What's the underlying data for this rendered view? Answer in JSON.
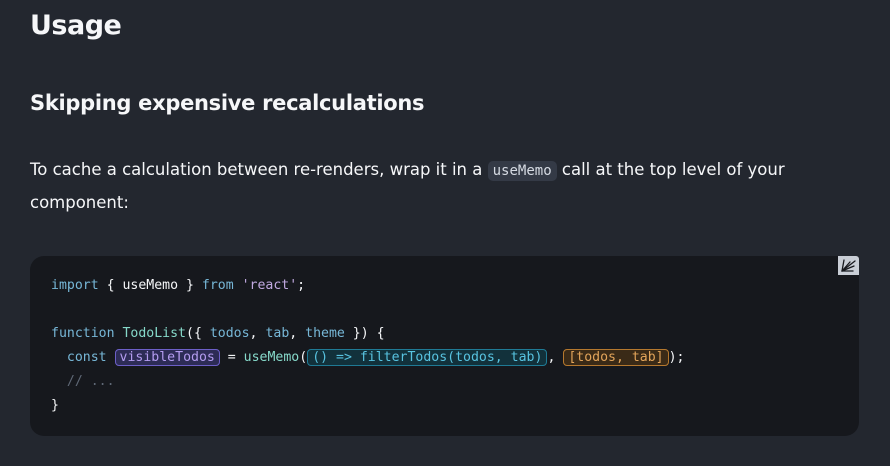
{
  "section": {
    "title": "Usage"
  },
  "subsection": {
    "title": "Skipping expensive recalculations"
  },
  "paragraph": {
    "text_before": "To cache a calculation between re-renders, wrap it in a ",
    "inline_code": "useMemo",
    "text_after": " call at the top level of your component:"
  },
  "code": {
    "copy_icon": "copy-icon",
    "line1": {
      "import_kw": "import",
      "open": " { ",
      "name": "useMemo",
      "close": " } ",
      "from_kw": "from",
      "module": "'react'",
      "end": ";"
    },
    "line3": {
      "function_kw": "function",
      "name": "TodoList",
      "open": "({ ",
      "p1": "todos",
      "c1": ", ",
      "p2": "tab",
      "c2": ", ",
      "p3": "theme",
      "close": " }) {"
    },
    "line4": {
      "indent": "  ",
      "const_kw": "const",
      "var_name": "visibleTodos",
      "assign": " = ",
      "call": "useMemo",
      "open": "(",
      "calc_fn": "() => filterTodos(todos, tab)",
      "sep": ", ",
      "deps": "[todos, tab]",
      "end": ");"
    },
    "line5": {
      "comment": "  // ..."
    },
    "line6": {
      "brace": "}"
    }
  },
  "colors": {
    "background": "#23272f",
    "code_background": "#16181d",
    "keyword": "#77b7d7",
    "string": "#c1a9e1",
    "function": "#86d9ca",
    "highlight_var": "#6c5fc7",
    "highlight_fn": "#1f7a95",
    "highlight_deps": "#b5782e"
  }
}
